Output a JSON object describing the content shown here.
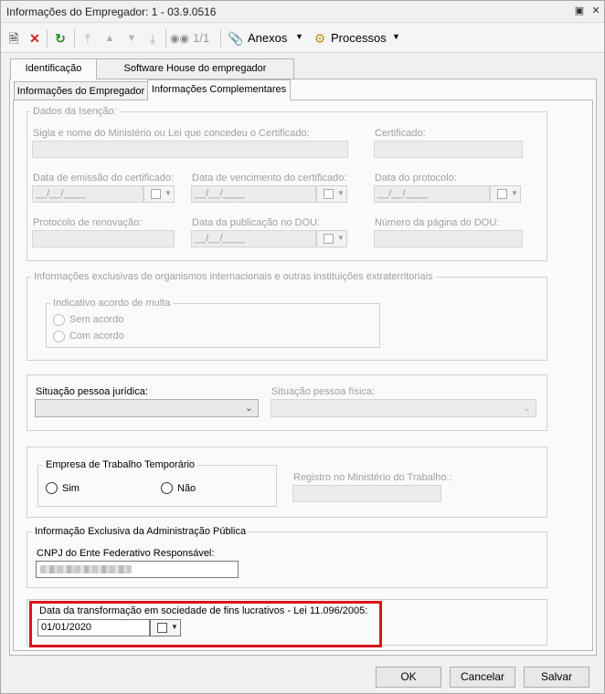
{
  "window": {
    "title": "Informações do Empregador: 1 - 03.9.0516"
  },
  "toolbar": {
    "record_counter": "1/1",
    "anexos_label": "Anexos",
    "processos_label": "Processos"
  },
  "tabs": {
    "outer": [
      "Identificação",
      "Software House do empregador"
    ],
    "inner": [
      "Informações do Empregador",
      "Informações Complementares"
    ]
  },
  "dados_isencao": {
    "legend": "Dados da Isenção:",
    "sigla_label": "Sigla e nome do Ministério ou Lei que concedeu o Certificado:",
    "certificado_label": "Certificado:",
    "data_emissao_label": "Data de emissão do certificado:",
    "data_emissao_value": "__/__/____",
    "data_vencimento_label": "Data de vencimento do certificado:",
    "data_vencimento_value": "__/__/____",
    "data_protocolo_label": "Data do protocolo:",
    "data_protocolo_value": "__/__/____",
    "protocolo_renovacao_label": "Protocolo de renovação:",
    "data_publicacao_label": "Data da publicação no DOU:",
    "data_publicacao_value": "__/__/____",
    "numero_pagina_label": "Número da página do DOU:"
  },
  "organismos": {
    "legend": "Informações exclusivas de organismos internacionais e outras instituições extraterritoriais",
    "acordo_legend": "Indicativo acordo de multa",
    "sem_acordo": "Sem acordo",
    "com_acordo": "Com acordo"
  },
  "situacao": {
    "pj_label": "Situação pessoa jurídica:",
    "pf_label": "Situação pessoa física:"
  },
  "trabalho_temporario": {
    "legend": "Empresa de Trabalho Temporário",
    "sim": "Sim",
    "nao": "Não",
    "registro_label": "Registro no Ministério do Trabalho.:"
  },
  "administracao_publica": {
    "legend": "Informação Exclusiva da Administração Pública",
    "cnpj_label": "CNPJ do Ente Federativo Responsável:"
  },
  "transformacao": {
    "label": "Data da transformação em sociedade de fins lucrativos - Lei 11.096/2005:",
    "value": "01/01/2020"
  },
  "footer": {
    "ok": "OK",
    "cancelar": "Cancelar",
    "salvar": "Salvar"
  },
  "colors": {
    "highlight": "#d9141b",
    "disabled_text": "#a0a0a0"
  }
}
